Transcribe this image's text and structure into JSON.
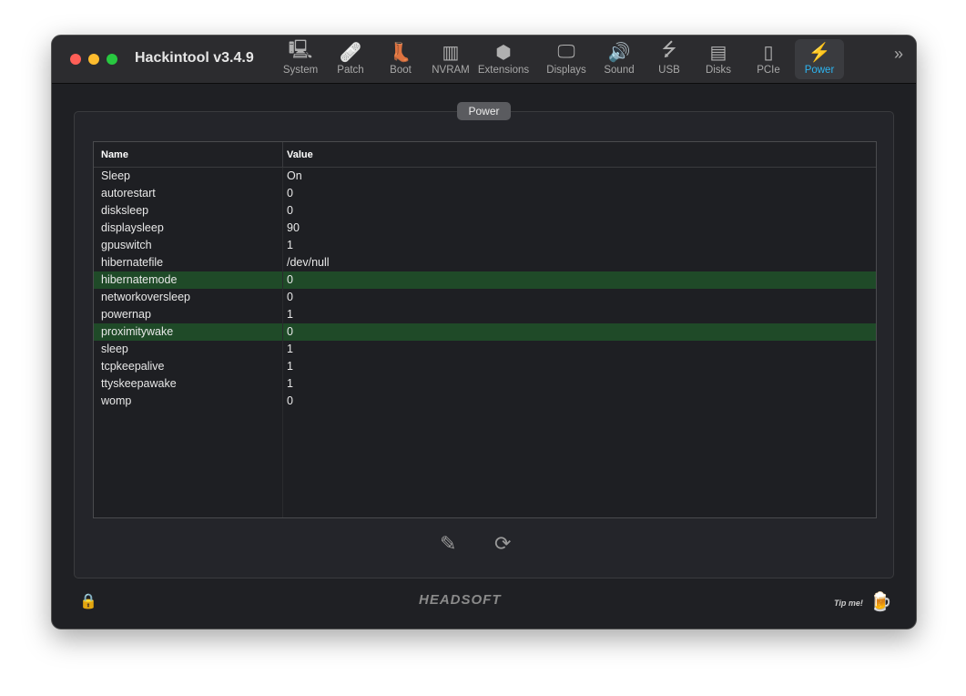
{
  "app": {
    "title": "Hackintool v3.4.9"
  },
  "toolbar": [
    {
      "label": "System",
      "icon": "computer-icon"
    },
    {
      "label": "Patch",
      "icon": "bandage-icon"
    },
    {
      "label": "Boot",
      "icon": "boot-icon"
    },
    {
      "label": "NVRAM",
      "icon": "nvram-icon"
    },
    {
      "label": "Extensions",
      "icon": "lego-icon"
    },
    {
      "label": "Displays",
      "icon": "display-icon"
    },
    {
      "label": "Sound",
      "icon": "speaker-icon"
    },
    {
      "label": "USB",
      "icon": "usb-icon"
    },
    {
      "label": "Disks",
      "icon": "disk-icon"
    },
    {
      "label": "PCIe",
      "icon": "pcie-icon"
    },
    {
      "label": "Power",
      "icon": "power-icon",
      "selected": true
    }
  ],
  "tab": {
    "label": "Power"
  },
  "table": {
    "headers": {
      "name": "Name",
      "value": "Value"
    },
    "rows": [
      {
        "name": "Sleep",
        "value": "On"
      },
      {
        "name": "autorestart",
        "value": "0"
      },
      {
        "name": "disksleep",
        "value": "0"
      },
      {
        "name": "displaysleep",
        "value": "90"
      },
      {
        "name": "gpuswitch",
        "value": "1"
      },
      {
        "name": "hibernatefile",
        "value": "/dev/null"
      },
      {
        "name": "hibernatemode",
        "value": "0",
        "highlighted": true
      },
      {
        "name": "networkoversleep",
        "value": "0"
      },
      {
        "name": "powernap",
        "value": "1"
      },
      {
        "name": "proximitywake",
        "value": "0",
        "highlighted": true
      },
      {
        "name": "sleep",
        "value": "1"
      },
      {
        "name": "tcpkeepalive",
        "value": "1"
      },
      {
        "name": "ttyskeepawake",
        "value": "1"
      },
      {
        "name": "womp",
        "value": "0"
      }
    ]
  },
  "footer": {
    "logo": "HEADSOFT",
    "tip": "Tip me!"
  },
  "colors": {
    "accent": "#2db4f0",
    "highlight": "#1f4a28"
  }
}
